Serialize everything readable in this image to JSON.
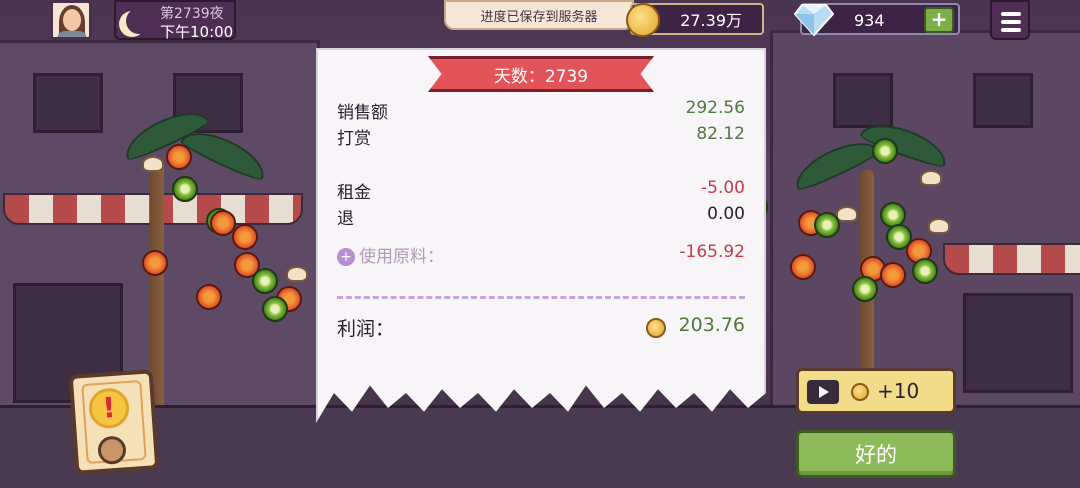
{
  "topbar": {
    "night_label": "第2739夜",
    "time_label": "下午10:00",
    "toast": "进度已保存到服务器",
    "coins": "27.39万",
    "gems": "934",
    "gem_plus": "+"
  },
  "receipt": {
    "title": "天数：2739",
    "sales_label": "销售额",
    "sales_value": "292.56",
    "tips_label": "打赏",
    "tips_value": "82.12",
    "rent_label": "租金",
    "rent_value": "-5.00",
    "refund_label": "退",
    "refund_value": "0.00",
    "ingredients_label": "使用原料：",
    "ingredients_plus": "+",
    "ingredients_value": "-165.92",
    "profit_label": "利润：",
    "profit_value": "203.76"
  },
  "buttons": {
    "video_reward": "+10",
    "ok": "好的"
  },
  "alert": {
    "mark": "!"
  },
  "colors": {
    "positive": "#4e7a3e",
    "negative": "#c43a4a",
    "ribbon": "#e2545a",
    "ok_button": "#8dbb5a"
  }
}
